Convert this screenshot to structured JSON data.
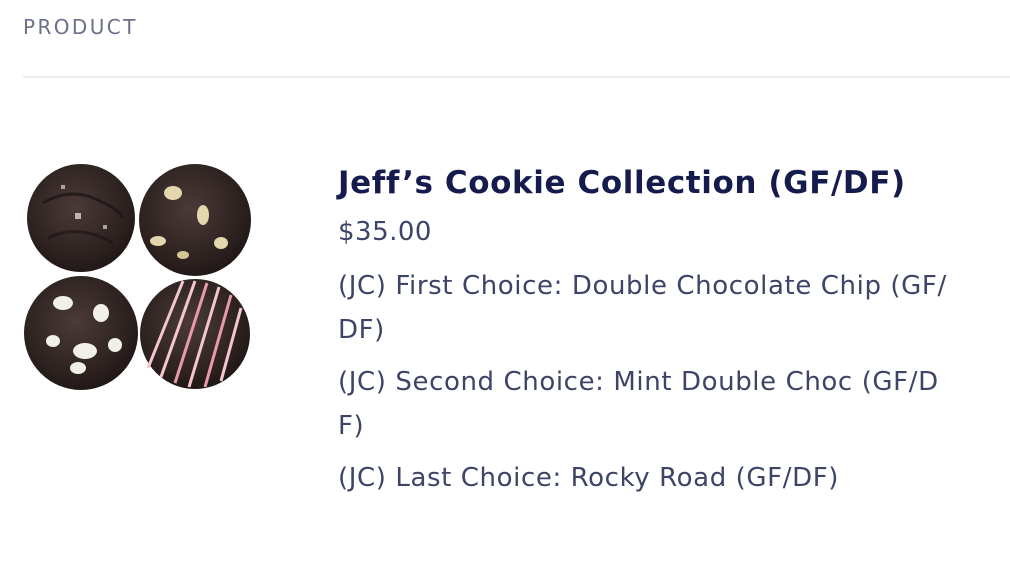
{
  "section": {
    "label": "PRODUCT"
  },
  "product": {
    "image_alt": "Four chocolate cookies",
    "title": "Jeff’s Cookie Collection (GF/DF)",
    "price": "$35.00",
    "options": [
      {
        "text": "(JC) First Choice: Double Chocolate Chip (GF/DF)"
      },
      {
        "text": "(JC) Second Choice: Mint Double Choc (GF/DF)"
      },
      {
        "text": "(JC) Last Choice: Rocky Road (GF/DF)"
      }
    ]
  },
  "colors": {
    "title": "#151b4d",
    "text": "#3d4466",
    "label": "#6b7088",
    "divider": "#ececef"
  }
}
